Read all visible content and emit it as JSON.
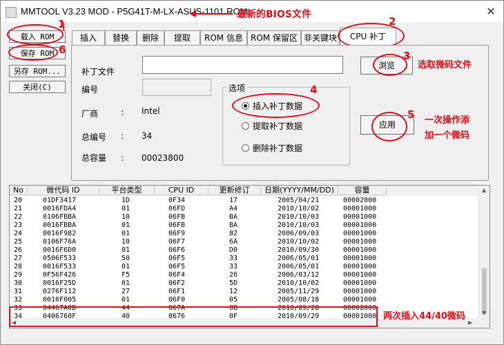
{
  "window": {
    "title": "MMTOOL V3.23 MOD - P5G41T-M-LX-ASUS-1101.ROM",
    "close": "✕"
  },
  "annotations": {
    "a_bios": "最新的BIOS文件",
    "a_browse": "选取微码文件",
    "a_apply1": "一次操作添",
    "a_apply2": "加一个微码",
    "a_rows": "两次插入44/40微码",
    "n1": "1",
    "n2": "2",
    "n3": "3",
    "n4": "4",
    "n5": "5",
    "n6": "6"
  },
  "sidebar": {
    "load": "载入 ROM",
    "save": "保存 ROM",
    "save_as": "另存 ROM...",
    "close": "关闭(C)"
  },
  "tabs": [
    "插入",
    "替换",
    "删除",
    "提取",
    "ROM 信息",
    "ROM 保留区",
    "非关键块",
    "CPU 补丁"
  ],
  "panel": {
    "patch_file_label": "补丁文件",
    "patch_file_value": "",
    "number_label": "编号",
    "number_value": "",
    "vendor_label": "厂商",
    "vendor_value": "Intel",
    "total_num_label": "总编号",
    "total_num_value": "34",
    "capacity_label": "总容量",
    "capacity_value": "00023800",
    "colon": ":",
    "browse": "浏览",
    "apply": "应用",
    "options_title": "选项",
    "opt_insert": "插入补丁数据",
    "opt_extract": "提取补丁数据",
    "opt_delete": "删除补丁数据"
  },
  "table": {
    "headers": [
      "No",
      "微代码 ID",
      "平台类型",
      "CPU ID",
      "更新修订",
      "日期(YYYY/MM/DD)",
      "容量"
    ],
    "rows": [
      [
        "20",
        "01DF3417",
        "1D",
        "0F34",
        "17",
        "2005/04/21",
        "00002000"
      ],
      [
        "21",
        "0016FDA4",
        "01",
        "06FD",
        "A4",
        "2010/10/02",
        "00001000"
      ],
      [
        "22",
        "0106FBBA",
        "10",
        "06FB",
        "BA",
        "2010/10/03",
        "00001000"
      ],
      [
        "23",
        "0016FBBA",
        "01",
        "06FB",
        "BA",
        "2010/10/03",
        "00001000"
      ],
      [
        "24",
        "0016F982",
        "01",
        "06F9",
        "82",
        "2006/09/03",
        "00001000"
      ],
      [
        "25",
        "0106F76A",
        "10",
        "06F7",
        "6A",
        "2010/10/02",
        "00001000"
      ],
      [
        "26",
        "0016F6D0",
        "01",
        "06F6",
        "D0",
        "2010/09/30",
        "00001000"
      ],
      [
        "27",
        "0506F533",
        "50",
        "06F5",
        "33",
        "2006/05/01",
        "00001000"
      ],
      [
        "28",
        "0016F533",
        "01",
        "06F5",
        "33",
        "2006/05/01",
        "00001000"
      ],
      [
        "29",
        "0F56F426",
        "F5",
        "06F4",
        "26",
        "2006/03/12",
        "00001000"
      ],
      [
        "30",
        "0016F25D",
        "01",
        "06F2",
        "5D",
        "2010/10/02",
        "00001000"
      ],
      [
        "31",
        "0276F112",
        "27",
        "06F1",
        "12",
        "2005/11/29",
        "00001000"
      ],
      [
        "32",
        "0016F005",
        "01",
        "06F0",
        "05",
        "2005/08/18",
        "00001000"
      ],
      [
        "33",
        "04467A0B",
        "44",
        "067A",
        "0B",
        "2010/09/28",
        "00002000"
      ],
      [
        "34",
        "0406760F",
        "40",
        "0676",
        "0F",
        "2010/09/29",
        "00001000"
      ]
    ]
  },
  "colors": {
    "annotation": "#e0101a"
  }
}
